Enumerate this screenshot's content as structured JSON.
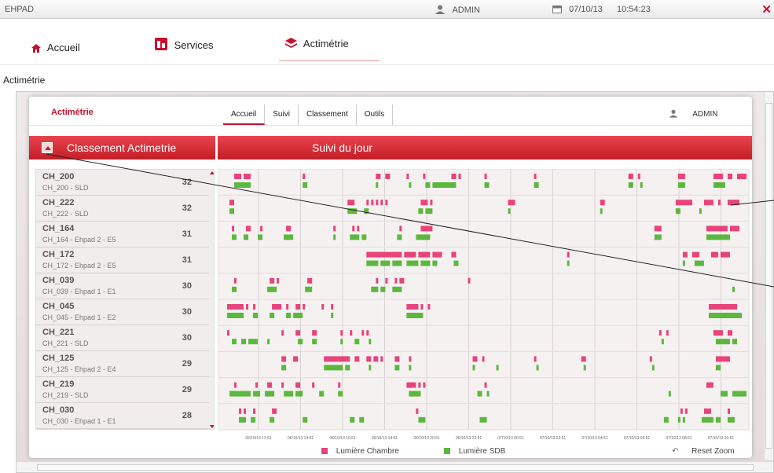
{
  "topbar": {
    "app_name": "EHPAD",
    "user": "ADMIN",
    "date": "07/10/13",
    "time": "10:54:23",
    "close_symbol": "✕"
  },
  "nav": {
    "tabs": [
      {
        "label": "Accueil",
        "icon": "home-icon"
      },
      {
        "label": "Services",
        "icon": "services-icon"
      },
      {
        "label": "Actimétrie",
        "icon": "layers-icon",
        "active": true
      }
    ]
  },
  "page_title": "Actimétrie",
  "panel": {
    "brand": "Actimétrie",
    "subtabs": [
      "Accueil",
      "Suivi",
      "Classement",
      "Outils"
    ],
    "user": "ADMIN",
    "left_header": "Classement Actimetrie",
    "right_header": "Suivi du jour"
  },
  "colors": {
    "chambre": "#e8437a",
    "sdb": "#5cb83c",
    "accent": "#c8102e"
  },
  "rooms": [
    {
      "name": "CH_200",
      "desc": "CH_200 - SLD",
      "count": "32"
    },
    {
      "name": "CH_222",
      "desc": "CH_222 - SLD",
      "count": "32"
    },
    {
      "name": "CH_164",
      "desc": "CH_164 - Ehpad 2 - E5",
      "count": "31"
    },
    {
      "name": "CH_172",
      "desc": "CH_172 - Ehpad 2 - E5",
      "count": "31"
    },
    {
      "name": "CH_039",
      "desc": "CH_039 - Ehpad 1 - E1",
      "count": "30"
    },
    {
      "name": "CH_045",
      "desc": "CH_045 - Ehpad 1 - E2",
      "count": "30"
    },
    {
      "name": "CH_221",
      "desc": "CH_221 - SLD",
      "count": "30"
    },
    {
      "name": "CH_125",
      "desc": "CH_125 - Ehpad 2 - E4",
      "count": "29"
    },
    {
      "name": "CH_219",
      "desc": "CH_219 - SLD",
      "count": "29"
    },
    {
      "name": "CH_030",
      "desc": "CH_030 - Ehpad 1 - E1",
      "count": "28"
    }
  ],
  "chart_data": {
    "type": "timeline",
    "x_ticks": [
      "06/10/13 12:51",
      "06/10/13 14:51",
      "06/10/13 16:51",
      "06/10/13 18:51",
      "06/10/13 20:51",
      "06/10/13 22:51",
      "07/10/13 00:51",
      "07/10/13 02:51",
      "07/10/13 04:51",
      "07/10/13 06:51",
      "07/10/13 08:51",
      "07/10/13 10:51"
    ],
    "legend": [
      "Lumière Chambre",
      "Lumière SDB"
    ],
    "grid": true,
    "rows": [
      {
        "chambre": [
          [
            0.7,
            1.0
          ],
          [
            1.1,
            1.4
          ],
          [
            3.6,
            3.7
          ],
          [
            6.7,
            6.9
          ],
          [
            7.1,
            7.3
          ],
          [
            8.0,
            8.1
          ],
          [
            8.7,
            8.8
          ],
          [
            9.9,
            10.1
          ],
          [
            10.2,
            10.3
          ],
          [
            11.3,
            11.4
          ],
          [
            13.4,
            13.5
          ],
          [
            17.4,
            17.6
          ],
          [
            17.8,
            17.9
          ],
          [
            19.5,
            19.8
          ],
          [
            21.0,
            21.4
          ],
          [
            21.6,
            21.8
          ],
          [
            22.0,
            22.4
          ]
        ],
        "sdb": [
          [
            0.7,
            1.4
          ],
          [
            3.6,
            3.8
          ],
          [
            6.7,
            6.8
          ],
          [
            8.1,
            8.2
          ],
          [
            8.8,
            9.0
          ],
          [
            9.1,
            10.1
          ],
          [
            11.3,
            11.5
          ],
          [
            13.4,
            13.6
          ],
          [
            17.4,
            17.6
          ],
          [
            17.9,
            18.0
          ],
          [
            19.5,
            19.8
          ],
          [
            21.0,
            21.5
          ]
        ]
      },
      {
        "chambre": [
          [
            0.5,
            0.7
          ],
          [
            5.5,
            5.8
          ],
          [
            6.3,
            6.4
          ],
          [
            6.5,
            6.6
          ],
          [
            6.7,
            6.8
          ],
          [
            6.9,
            7.0
          ],
          [
            7.1,
            7.2
          ],
          [
            8.6,
            8.9
          ],
          [
            9.0,
            9.1
          ],
          [
            12.3,
            12.6
          ],
          [
            16.2,
            16.4
          ],
          [
            19.4,
            20.1
          ],
          [
            20.6,
            21.0
          ],
          [
            21.2,
            21.3
          ],
          [
            21.6,
            22.1
          ]
        ],
        "sdb": [
          [
            0.5,
            0.7
          ],
          [
            5.5,
            5.9
          ],
          [
            6.2,
            6.4
          ],
          [
            8.5,
            8.7
          ],
          [
            8.8,
            9.1
          ],
          [
            12.3,
            12.4
          ],
          [
            16.2,
            16.3
          ],
          [
            19.4,
            19.6
          ],
          [
            20.4,
            20.5
          ]
        ]
      },
      {
        "chambre": [
          [
            0.6,
            0.7
          ],
          [
            1.2,
            1.4
          ],
          [
            1.8,
            1.9
          ],
          [
            2.9,
            3.1
          ],
          [
            4.9,
            5.0
          ],
          [
            5.7,
            5.8
          ],
          [
            5.9,
            6.0
          ],
          [
            7.7,
            7.8
          ],
          [
            8.6,
            9.1
          ],
          [
            18.5,
            18.8
          ],
          [
            20.7,
            21.6
          ],
          [
            21.7,
            22.1
          ]
        ],
        "sdb": [
          [
            0.6,
            0.8
          ],
          [
            1.1,
            1.3
          ],
          [
            1.7,
            1.9
          ],
          [
            2.8,
            3.2
          ],
          [
            4.9,
            5.0
          ],
          [
            5.6,
            6.0
          ],
          [
            6.1,
            6.3
          ],
          [
            7.6,
            7.8
          ],
          [
            8.4,
            9.0
          ],
          [
            18.5,
            18.8
          ],
          [
            20.7,
            21.7
          ]
        ]
      },
      {
        "chambre": [
          [
            6.3,
            7.8
          ],
          [
            7.9,
            8.4
          ],
          [
            8.5,
            9.0
          ],
          [
            9.1,
            9.5
          ],
          [
            9.9,
            10.1
          ],
          [
            14.8,
            14.9
          ],
          [
            19.7,
            19.9
          ],
          [
            20.1,
            20.4
          ],
          [
            20.9,
            21.2
          ],
          [
            21.3,
            21.7
          ]
        ],
        "sdb": [
          [
            6.3,
            6.8
          ],
          [
            6.9,
            7.3
          ],
          [
            7.4,
            7.8
          ],
          [
            8.0,
            8.5
          ],
          [
            8.6,
            9.0
          ],
          [
            9.1,
            9.3
          ],
          [
            10.0,
            10.2
          ],
          [
            14.8,
            14.9
          ],
          [
            19.7,
            19.8
          ],
          [
            20.2,
            20.6
          ]
        ]
      },
      {
        "chambre": [
          [
            0.7,
            0.8
          ],
          [
            2.2,
            2.4
          ],
          [
            2.5,
            2.6
          ],
          [
            3.8,
            4.0
          ],
          [
            6.7,
            6.8
          ],
          [
            7.1,
            7.2
          ],
          [
            7.5,
            7.6
          ],
          [
            7.7,
            7.9
          ],
          [
            10.6,
            10.7
          ]
        ],
        "sdb": [
          [
            0.6,
            0.8
          ],
          [
            2.1,
            2.5
          ],
          [
            3.7,
            4.0
          ],
          [
            6.5,
            6.8
          ],
          [
            6.9,
            7.1
          ],
          [
            7.4,
            7.8
          ],
          [
            21.8,
            21.9
          ]
        ]
      },
      {
        "chambre": [
          [
            0.4,
            1.1
          ],
          [
            1.2,
            1.3
          ],
          [
            1.5,
            1.6
          ],
          [
            2.3,
            2.7
          ],
          [
            2.9,
            3.0
          ],
          [
            3.3,
            3.5
          ],
          [
            3.6,
            3.7
          ],
          [
            4.4,
            4.5
          ],
          [
            4.8,
            4.9
          ],
          [
            8.0,
            8.5
          ],
          [
            8.6,
            8.7
          ],
          [
            8.9,
            9.0
          ],
          [
            20.8,
            22.0
          ]
        ],
        "sdb": [
          [
            0.4,
            1.1
          ],
          [
            1.5,
            1.7
          ],
          [
            2.2,
            2.4
          ],
          [
            2.9,
            3.1
          ],
          [
            3.2,
            3.6
          ],
          [
            4.8,
            4.9
          ],
          [
            8.0,
            8.7
          ],
          [
            20.8,
            22.2
          ]
        ]
      },
      {
        "chambre": [
          [
            0.4,
            0.5
          ],
          [
            2.7,
            2.8
          ],
          [
            3.3,
            3.5
          ],
          [
            4.0,
            4.2
          ],
          [
            5.2,
            5.3
          ],
          [
            5.6,
            5.7
          ],
          [
            6.1,
            6.2
          ],
          [
            6.3,
            6.4
          ],
          [
            18.7,
            18.8
          ],
          [
            19.0,
            19.1
          ],
          [
            21.0,
            21.4
          ],
          [
            21.6,
            21.8
          ]
        ],
        "sdb": [
          [
            0.6,
            0.8
          ],
          [
            1.0,
            1.2
          ],
          [
            1.3,
            1.7
          ],
          [
            2.1,
            2.2
          ],
          [
            3.4,
            3.6
          ],
          [
            4.0,
            4.2
          ],
          [
            5.2,
            5.3
          ],
          [
            5.8,
            6.0
          ],
          [
            6.4,
            6.5
          ],
          [
            18.8,
            18.9
          ],
          [
            21.1,
            21.7
          ],
          [
            21.8,
            22.0
          ]
        ]
      },
      {
        "chambre": [
          [
            2.7,
            2.9
          ],
          [
            3.2,
            3.4
          ],
          [
            4.5,
            5.6
          ],
          [
            5.8,
            6.0
          ],
          [
            6.3,
            6.5
          ],
          [
            6.6,
            6.8
          ],
          [
            6.9,
            7.0
          ],
          [
            7.5,
            7.7
          ],
          [
            8.1,
            8.2
          ],
          [
            10.8,
            11.0
          ],
          [
            11.2,
            11.3
          ],
          [
            13.4,
            13.5
          ],
          [
            15.4,
            15.6
          ],
          [
            18.3,
            18.4
          ],
          [
            21.1,
            21.7
          ]
        ],
        "sdb": [
          [
            2.7,
            2.9
          ],
          [
            4.5,
            5.3
          ],
          [
            5.4,
            5.6
          ],
          [
            6.4,
            6.5
          ],
          [
            7.5,
            7.7
          ],
          [
            8.1,
            8.2
          ],
          [
            10.8,
            10.9
          ],
          [
            11.8,
            11.9
          ],
          [
            13.5,
            13.6
          ],
          [
            15.5,
            15.6
          ],
          [
            18.4,
            18.5
          ],
          [
            21.1,
            21.3
          ]
        ]
      },
      {
        "chambre": [
          [
            0.7,
            0.8
          ],
          [
            1.6,
            1.7
          ],
          [
            2.1,
            2.3
          ],
          [
            2.7,
            2.8
          ],
          [
            3.3,
            3.5
          ],
          [
            4.0,
            4.1
          ],
          [
            5.1,
            5.2
          ],
          [
            8.0,
            8.4
          ],
          [
            8.5,
            8.6
          ],
          [
            8.7,
            8.8
          ],
          [
            11.3,
            11.4
          ],
          [
            20.7,
            21.0
          ]
        ],
        "sdb": [
          [
            0.5,
            1.4
          ],
          [
            1.5,
            1.8
          ],
          [
            2.0,
            2.4
          ],
          [
            2.8,
            3.2
          ],
          [
            3.3,
            3.6
          ],
          [
            4.3,
            4.5
          ],
          [
            5.1,
            5.3
          ],
          [
            8.1,
            8.6
          ],
          [
            11.0,
            11.2
          ],
          [
            11.4,
            11.5
          ],
          [
            19.1,
            19.2
          ],
          [
            21.3,
            21.6
          ],
          [
            21.8,
            22.4
          ]
        ]
      },
      {
        "chambre": [
          [
            0.9,
            1.0
          ],
          [
            1.1,
            1.2
          ],
          [
            1.5,
            1.6
          ],
          [
            2.3,
            2.5
          ],
          [
            8.4,
            8.5
          ],
          [
            19.6,
            19.7
          ],
          [
            19.8,
            19.9
          ],
          [
            20.6,
            20.9
          ],
          [
            21.6,
            21.7
          ]
        ],
        "sdb": [
          [
            0.9,
            1.2
          ],
          [
            1.4,
            1.6
          ],
          [
            2.2,
            2.4
          ],
          [
            3.6,
            3.8
          ],
          [
            5.6,
            5.8
          ],
          [
            6.0,
            6.2
          ],
          [
            8.5,
            8.8
          ],
          [
            11.1,
            11.4
          ],
          [
            18.9,
            19.1
          ],
          [
            19.5,
            19.6
          ],
          [
            19.7,
            19.8
          ],
          [
            20.5,
            21.0
          ],
          [
            21.1,
            21.3
          ],
          [
            21.6,
            21.9
          ]
        ]
      }
    ],
    "x_range_hours": [
      0,
      22.5
    ]
  },
  "footer": {
    "legend_chambre": "Lumière Chambre",
    "legend_sdb": "Lumière SDB",
    "reset_zoom": "Reset Zoom"
  }
}
